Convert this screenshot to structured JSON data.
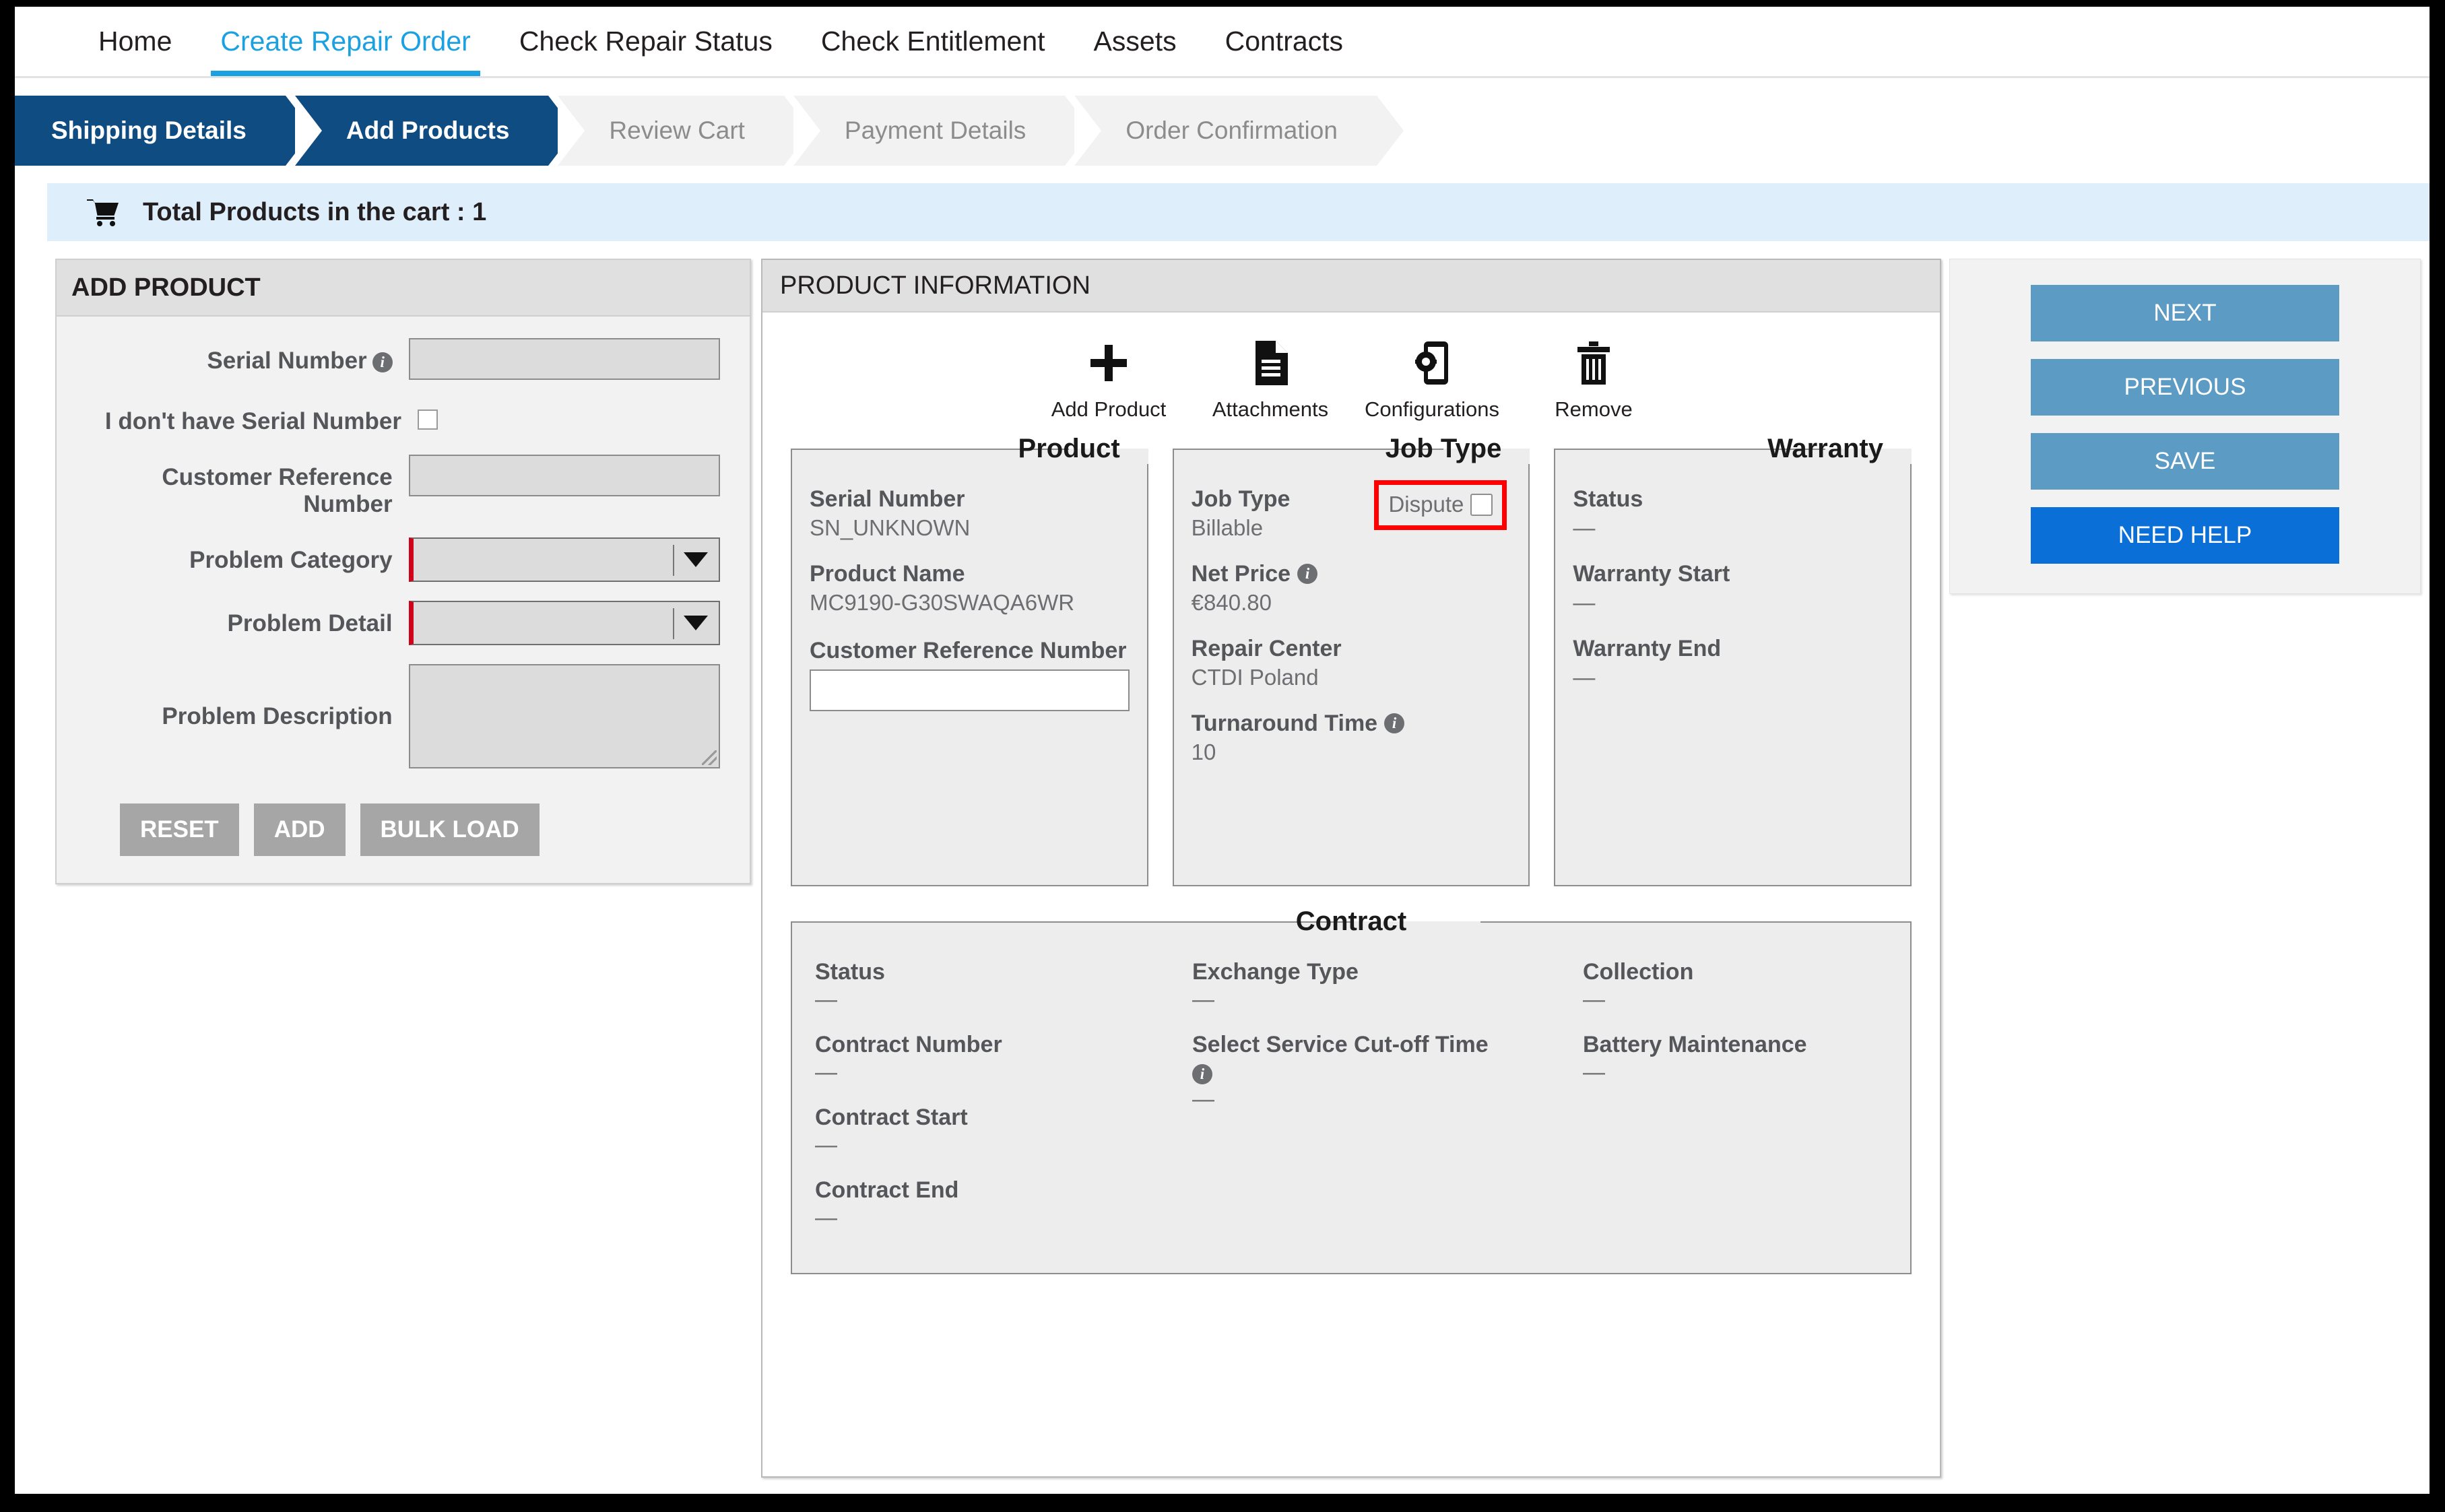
{
  "nav": {
    "items": [
      {
        "label": "Home",
        "active": false
      },
      {
        "label": "Create Repair Order",
        "active": true
      },
      {
        "label": "Check Repair Status",
        "active": false
      },
      {
        "label": "Check Entitlement",
        "active": false
      },
      {
        "label": "Assets",
        "active": false
      },
      {
        "label": "Contracts",
        "active": false
      }
    ]
  },
  "stepper": {
    "steps": [
      {
        "label": "Shipping Details",
        "state": "done"
      },
      {
        "label": "Add Products",
        "state": "current"
      },
      {
        "label": "Review Cart",
        "state": "todo"
      },
      {
        "label": "Payment Details",
        "state": "todo"
      },
      {
        "label": "Order Confirmation",
        "state": "todo"
      }
    ]
  },
  "cart": {
    "icon": "shopping-cart-icon",
    "label": "Total Products in the cart : 1"
  },
  "add_product": {
    "title": "ADD PRODUCT",
    "fields": {
      "serial_number_label": "Serial Number",
      "serial_number_value": "",
      "no_serial_label": "I don't have Serial Number",
      "no_serial_checked": false,
      "customer_ref_label": "Customer Reference Number",
      "customer_ref_value": "",
      "problem_category_label": "Problem Category",
      "problem_category_value": "",
      "problem_detail_label": "Problem Detail",
      "problem_detail_value": "",
      "problem_description_label": "Problem Description",
      "problem_description_value": ""
    },
    "buttons": {
      "reset": "RESET",
      "add": "ADD",
      "bulk_load": "BULK LOAD"
    }
  },
  "product_information": {
    "title": "PRODUCT INFORMATION",
    "toolbar": [
      {
        "label": "Add Product",
        "icon": "plus-icon"
      },
      {
        "label": "Attachments",
        "icon": "document-icon"
      },
      {
        "label": "Configurations",
        "icon": "device-gear-icon"
      },
      {
        "label": "Remove",
        "icon": "trash-icon"
      }
    ],
    "product": {
      "legend": "Product",
      "serial_number_label": "Serial Number",
      "serial_number_value": "SN_UNKNOWN",
      "product_name_label": "Product Name",
      "product_name_value": "MC9190-G30SWAQA6WR",
      "customer_ref_label": "Customer Reference Number",
      "customer_ref_value": ""
    },
    "job_type": {
      "legend": "Job Type",
      "job_type_label": "Job Type",
      "job_type_value": "Billable",
      "dispute_label": "Dispute",
      "dispute_checked": false,
      "net_price_label": "Net Price",
      "net_price_value": "€840.80",
      "repair_center_label": "Repair Center",
      "repair_center_value": "CTDI Poland",
      "turnaround_label": "Turnaround Time",
      "turnaround_value": "10"
    },
    "warranty": {
      "legend": "Warranty",
      "status_label": "Status",
      "status_value": "—",
      "start_label": "Warranty Start",
      "start_value": "—",
      "end_label": "Warranty End",
      "end_value": "—"
    },
    "contract": {
      "legend": "Contract",
      "col1": [
        {
          "label": "Status",
          "value": "—"
        },
        {
          "label": "Contract Number",
          "value": "—"
        },
        {
          "label": "Contract Start",
          "value": "—"
        },
        {
          "label": "Contract End",
          "value": "—"
        }
      ],
      "col2": [
        {
          "label": "Exchange Type",
          "value": "—"
        },
        {
          "label": "Select Service Cut-off Time",
          "value": "—",
          "info": true
        }
      ],
      "col3": [
        {
          "label": "Collection",
          "value": "—"
        },
        {
          "label": "Battery Maintenance",
          "value": "—"
        }
      ]
    }
  },
  "sidebar": {
    "buttons": [
      {
        "label": "NEXT",
        "style": "primary"
      },
      {
        "label": "PREVIOUS",
        "style": "primary"
      },
      {
        "label": "SAVE",
        "style": "primary"
      },
      {
        "label": "NEED HELP",
        "style": "help"
      }
    ]
  },
  "colors": {
    "accent": "#1ba1e2",
    "step_active": "#0f4c81",
    "button_blue": "#5b9bc4",
    "help_blue": "#0b6fd8",
    "required_red": "#d0021b",
    "highlight_red": "#ff0000",
    "cart_bg": "#dfeefb"
  }
}
